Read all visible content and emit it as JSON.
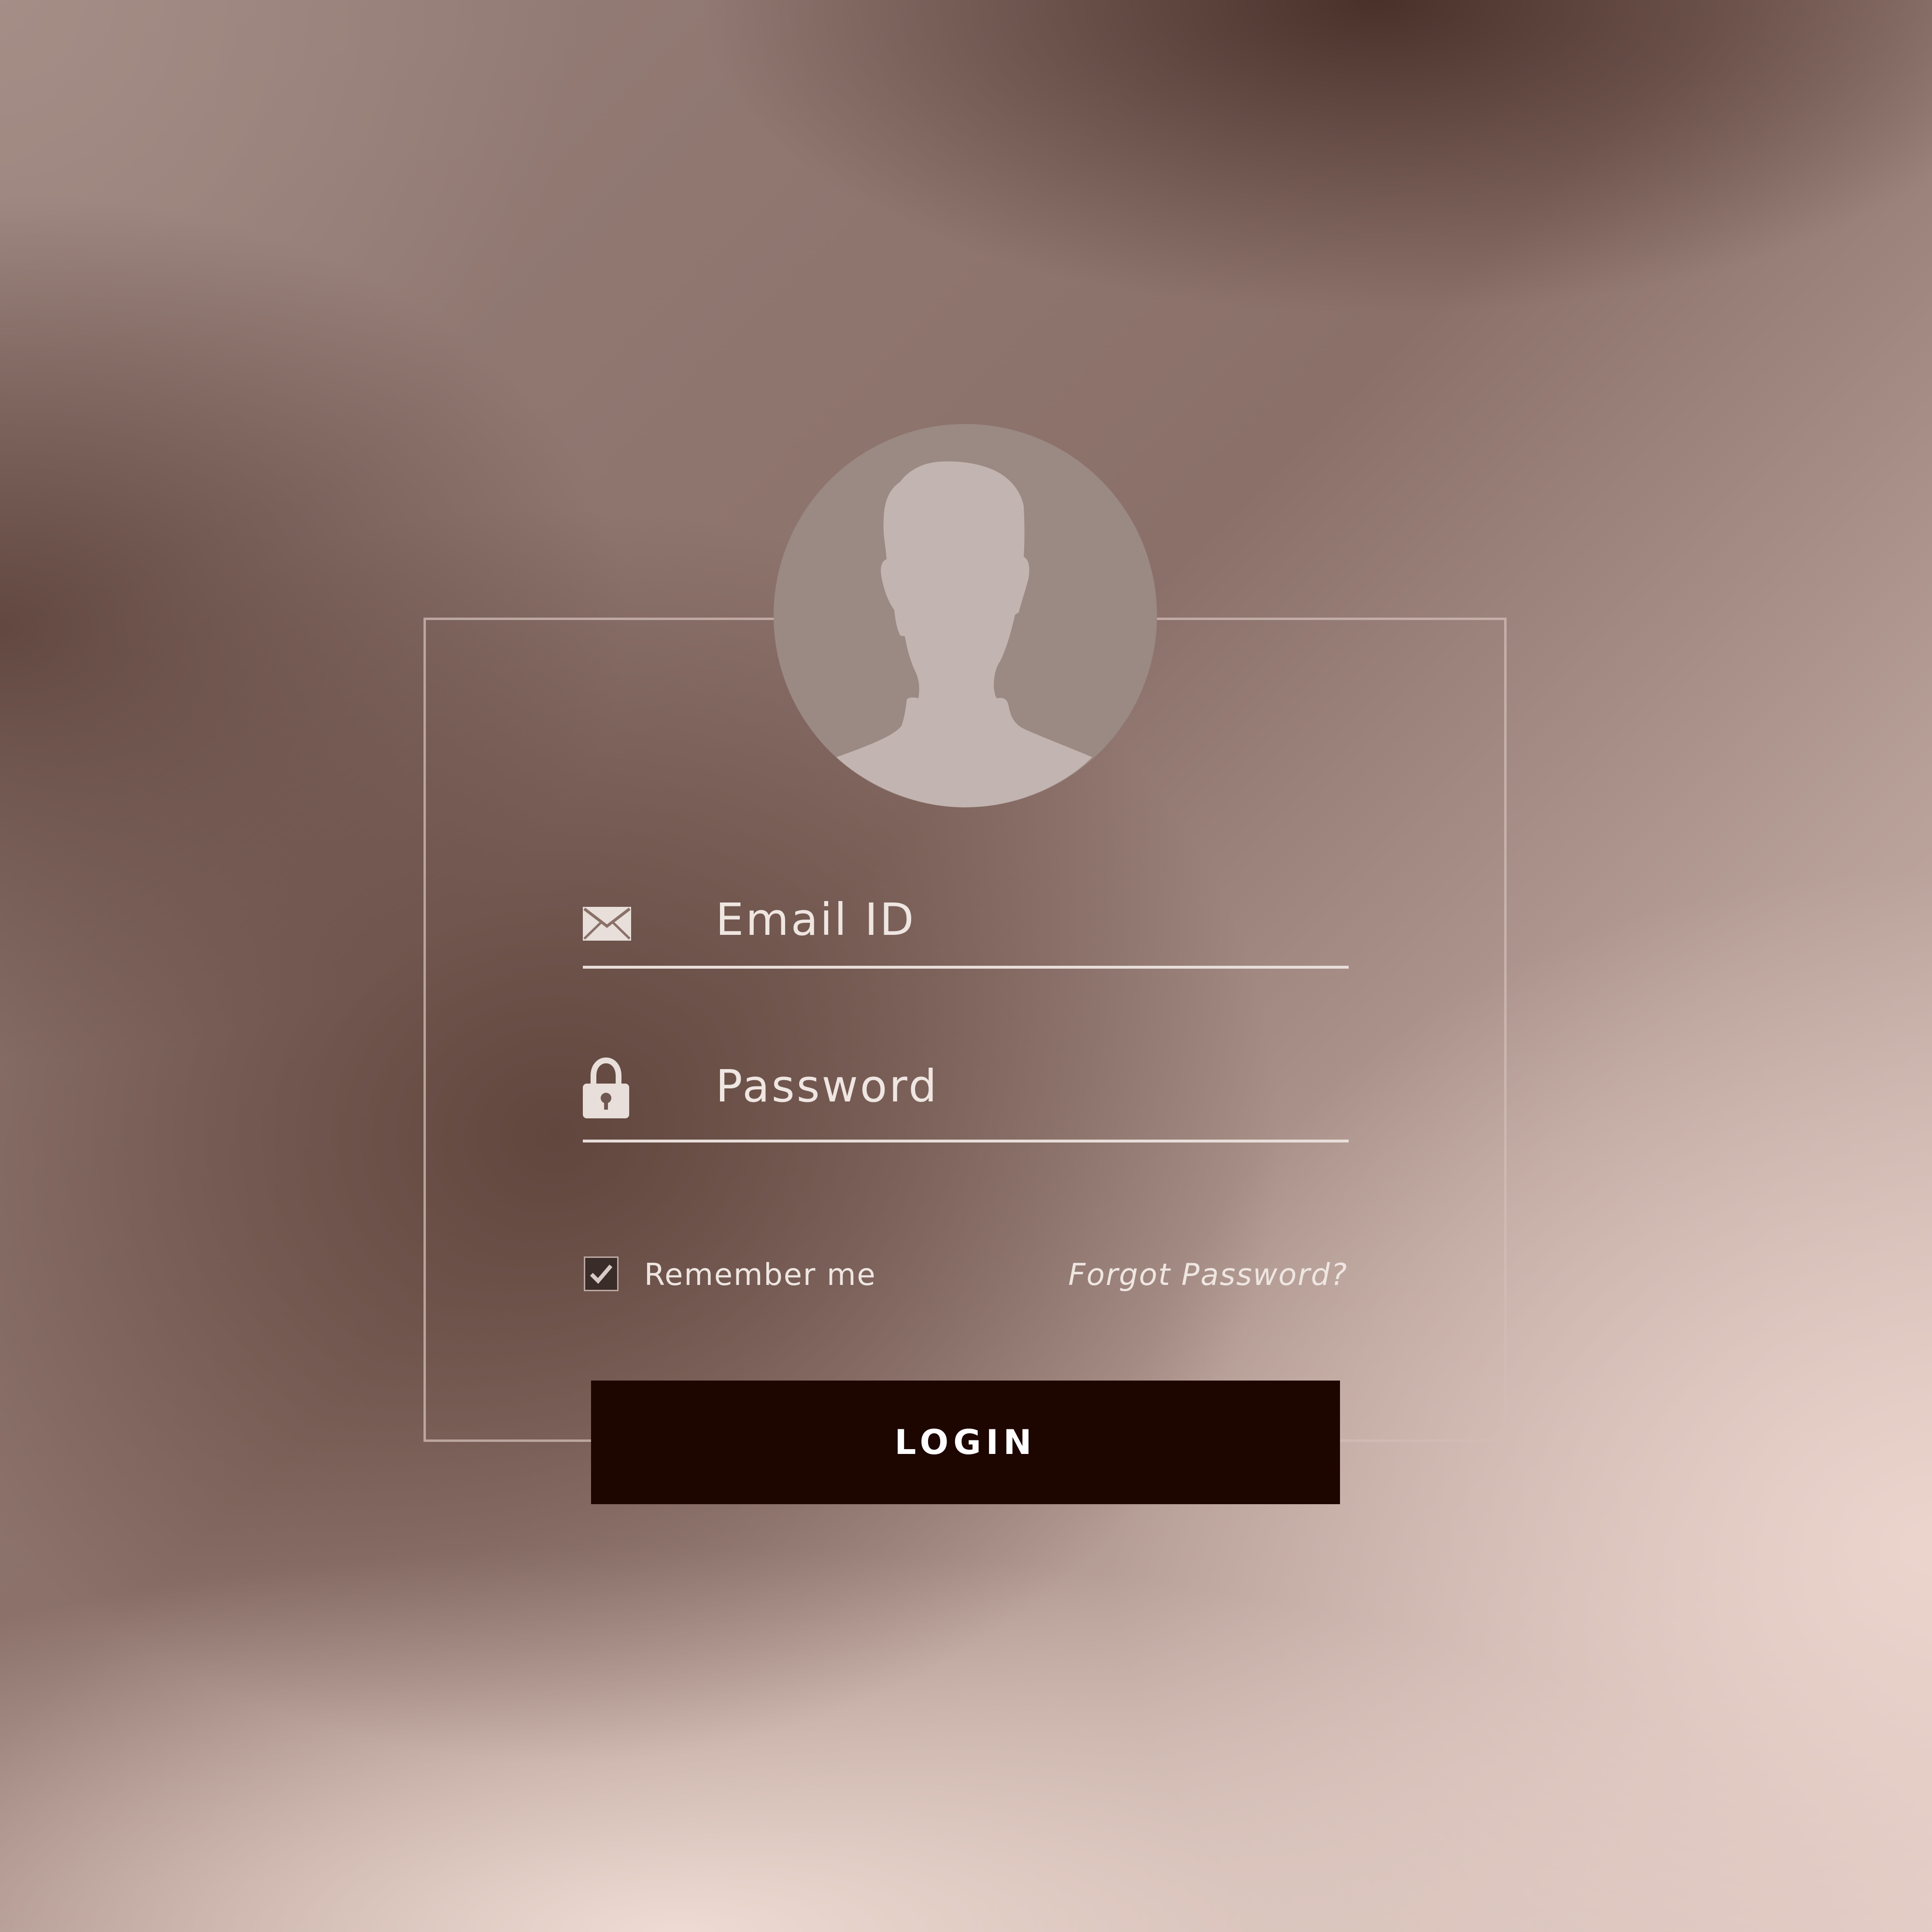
{
  "form": {
    "email_placeholder": "Email ID",
    "password_placeholder": "Password",
    "remember_label": "Remember me",
    "remember_checked": true,
    "forgot_link": "Forgot Password?",
    "login_button": "LOGIN"
  },
  "icons": {
    "avatar": "user-silhouette-icon",
    "email": "envelope-icon",
    "password": "padlock-icon",
    "checkbox": "checkmark-icon"
  },
  "colors": {
    "button_bg": "#1d0500",
    "button_text": "#ffffff",
    "text": "#efe6e2",
    "frame": "#d2beb7",
    "avatar_bg": "#9b8983",
    "avatar_silhouette": "#c2b4b0"
  }
}
